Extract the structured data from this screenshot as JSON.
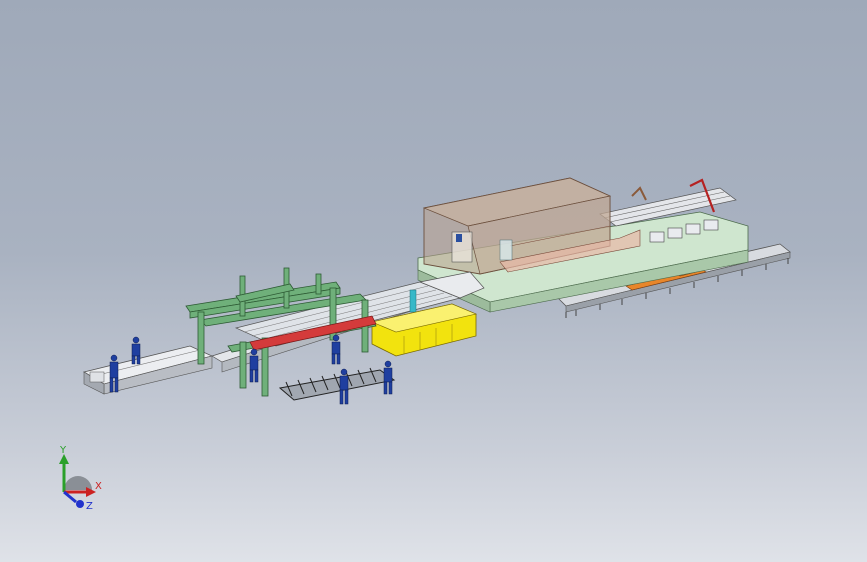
{
  "viewport": {
    "background_top": "#9fa9b9",
    "background_bottom": "#dfe2e8"
  },
  "triad": {
    "x_label": "X",
    "y_label": "Y",
    "z_label": "Z",
    "x_color": "#cc2222",
    "y_color": "#2aa02a",
    "z_color": "#2233cc"
  },
  "model_colors": {
    "frame_green": "#6fb07a",
    "base_green": "#cfe6cf",
    "enclosure": "#b9a08c",
    "yellow_hopper": "#f2e30e",
    "red_beam": "#d43b3b",
    "orange_strip": "#e8862a",
    "worker_blue": "#1f3fa0",
    "conveyor_gray": "#d8dbe0"
  }
}
